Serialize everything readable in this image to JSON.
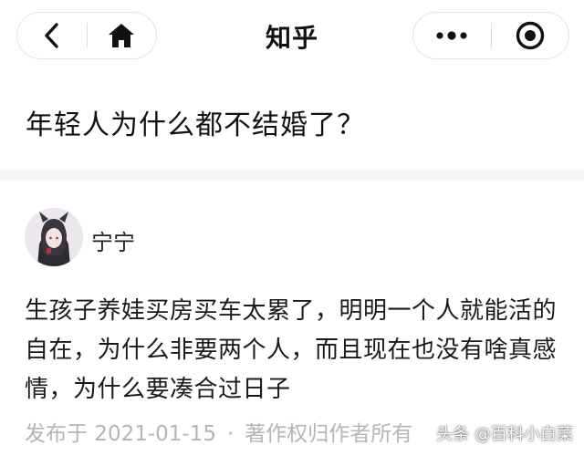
{
  "header": {
    "app_title": "知乎",
    "back_icon": "back-chevron-icon",
    "home_icon": "home-icon",
    "more_icon": "more-dots-icon",
    "close_icon": "target-close-icon"
  },
  "question": {
    "title": "年轻人为什么都不结婚了？"
  },
  "answer": {
    "author": "宁宁",
    "text": "生孩子养娃买房买车太累了，明明一个人就能活的自在，为什么非要两个人，而且现在也没有啥真感情，为什么要凑合过日子",
    "published_label": "发布于 2021-01-15",
    "separator": "·",
    "copyright": "著作权归作者所有"
  },
  "watermark": {
    "text": "头条 @百科小白菜"
  }
}
